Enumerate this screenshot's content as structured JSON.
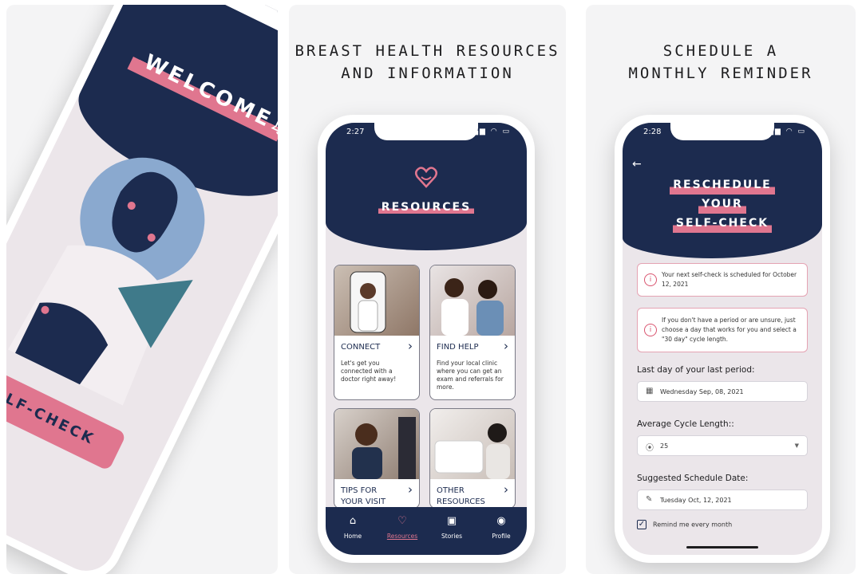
{
  "panel1": {
    "welcome": "WELCOME",
    "self_check_button": "SELF-CHECK"
  },
  "panel2": {
    "heading_line1": "BREAST HEALTH RESOURCES",
    "heading_line2": "AND INFORMATION",
    "status_time": "2:27",
    "screen_title": "RESOURCES",
    "cards": [
      {
        "title": "CONNECT",
        "desc": "Let's get you connected with a doctor right away!"
      },
      {
        "title": "FIND HELP",
        "desc": "Find your local clinic where you can get an exam and referrals for more."
      },
      {
        "title": "TIPS FOR YOUR VISIT",
        "desc": ""
      },
      {
        "title": "OTHER RESOURCES",
        "desc": ""
      }
    ],
    "tabs": [
      {
        "label": "Home",
        "icon": "home-icon"
      },
      {
        "label": "Resources",
        "icon": "heart-icon"
      },
      {
        "label": "Stories",
        "icon": "book-icon"
      },
      {
        "label": "Profile",
        "icon": "profile-icon"
      }
    ]
  },
  "panel3": {
    "heading_line1": "SCHEDULE A",
    "heading_line2": "MONTHLY REMINDER",
    "status_time": "2:28",
    "title_line1": "RESCHEDULE",
    "title_line2": "YOUR",
    "title_line3": "SELF-CHECK",
    "info1": "Your next self-check is scheduled for October 12, 2021",
    "info2": "If you don't have a period or are unsure, just choose a day that works for you and select a \"30 day\" cycle length.",
    "last_period_label": "Last day of your last period:",
    "last_period_value": "Wednesday Sep, 08, 2021",
    "cycle_label": "Average Cycle Length::",
    "cycle_value": "25",
    "suggested_label": "Suggested Schedule Date:",
    "suggested_value": "Tuesday Oct, 12, 2021",
    "remind_label": "Remind me every month"
  },
  "colors": {
    "navy": "#1c2b4f",
    "pink": "#e0768f",
    "background": "#ebe6ea"
  }
}
